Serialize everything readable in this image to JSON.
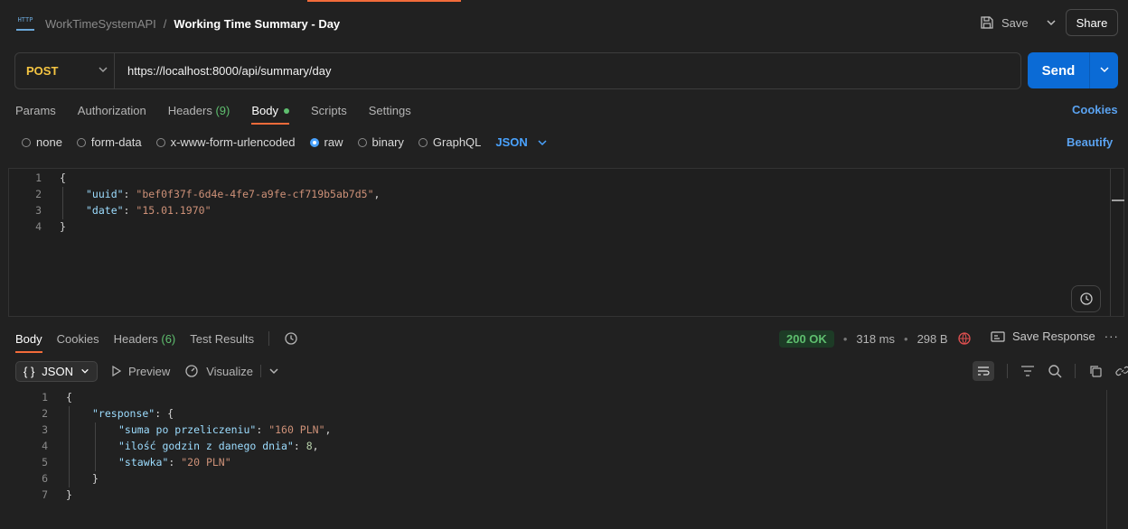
{
  "breadcrumb": {
    "collection": "WorkTimeSystemAPI",
    "separator": "/",
    "request": "Working Time Summary - Day",
    "http_icon": "HTTP"
  },
  "header": {
    "save_label": "Save",
    "share_label": "Share"
  },
  "request": {
    "method": "POST",
    "url": "https://localhost:8000/api/summary/day",
    "send_label": "Send"
  },
  "req_tabs": {
    "params": "Params",
    "authorization": "Authorization",
    "headers": "Headers",
    "headers_count": "(9)",
    "body": "Body",
    "scripts": "Scripts",
    "settings": "Settings",
    "cookies": "Cookies"
  },
  "body_types": {
    "none": "none",
    "form_data": "form-data",
    "urlencoded": "x-www-form-urlencoded",
    "raw": "raw",
    "binary": "binary",
    "graphql": "GraphQL",
    "json": "JSON",
    "beautify": "Beautify",
    "selected": "raw"
  },
  "req_code": {
    "ln": [
      "1",
      "2",
      "3",
      "4"
    ],
    "brace_open": "{",
    "brace_close": "}",
    "k_uuid": "\"uuid\"",
    "v_uuid": "\"bef0f37f-6d4e-4fe7-a9fe-cf719b5ab7d5\"",
    "k_date": "\"date\"",
    "v_date": "\"15.01.1970\""
  },
  "resp_tabs": {
    "body": "Body",
    "cookies": "Cookies",
    "headers": "Headers",
    "headers_count": "(6)",
    "test_results": "Test Results"
  },
  "status": {
    "code": "200 OK",
    "time": "318 ms",
    "size": "298 B",
    "save_response": "Save Response"
  },
  "format": {
    "json": "JSON",
    "braces": "{ }",
    "preview": "Preview",
    "visualize": "Visualize"
  },
  "resp_code": {
    "ln": [
      "1",
      "2",
      "3",
      "4",
      "5",
      "6",
      "7"
    ],
    "brace_open": "{",
    "brace_close": "}",
    "k_response": "\"response\"",
    "k_suma": "\"suma po przeliczeniu\"",
    "v_suma": "\"160 PLN\"",
    "k_ilosc": "\"ilość godzin z danego dnia\"",
    "v_ilosc": "8",
    "k_stawka": "\"stawka\"",
    "v_stawka": "\"20 PLN\""
  },
  "colors": {
    "accent": "#f26b3a",
    "send": "#0b6bd6",
    "method": "#f5c542",
    "ok": "#5fbf6f",
    "link": "#5aa2f0"
  }
}
